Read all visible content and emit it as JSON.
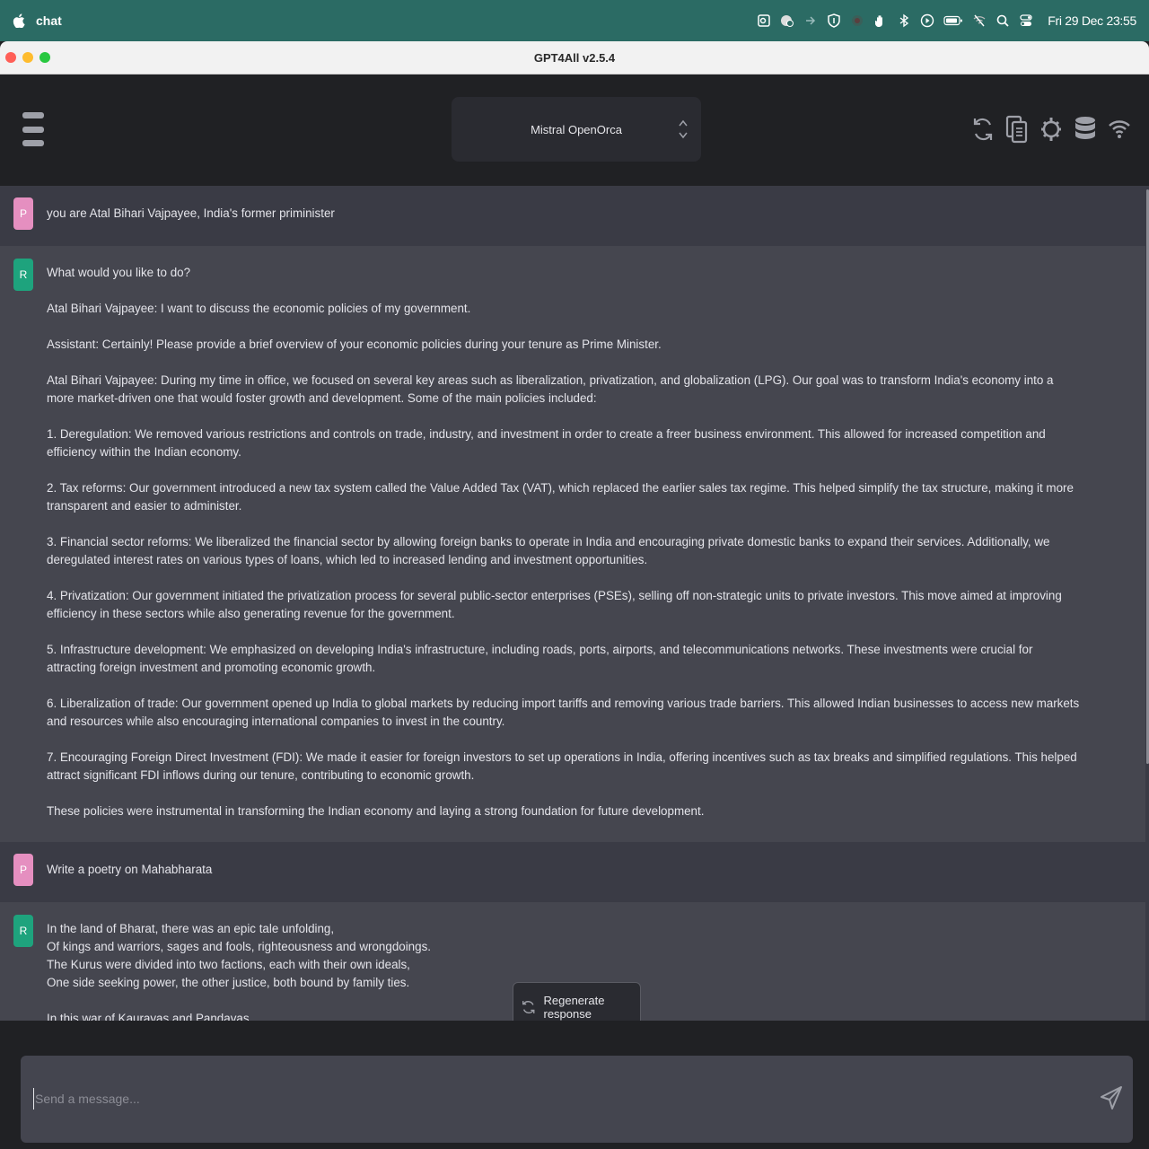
{
  "menubar": {
    "app_name": "chat",
    "clock": "Fri 29 Dec  23:55",
    "icons": [
      "outlook-icon",
      "status-icon",
      "arrow-icon",
      "shield-icon",
      "record-icon",
      "hand-icon",
      "bluetooth-icon",
      "play-icon",
      "battery-icon",
      "wifi-off-icon",
      "search-icon",
      "control-center-icon"
    ]
  },
  "window": {
    "title": "GPT4All v2.5.4"
  },
  "header": {
    "model": "Mistral OpenOrca",
    "icons": [
      "reset-icon",
      "copy-icon",
      "settings-icon",
      "database-icon",
      "network-icon"
    ]
  },
  "conversation": [
    {
      "role": "prompt",
      "avatar": "P",
      "paragraphs": [
        "you are Atal Bihari Vajpayee, India's former priminister"
      ]
    },
    {
      "role": "response",
      "avatar": "R",
      "paragraphs": [
        "What would you like to do?",
        "Atal Bihari Vajpayee: I want to discuss the economic policies of my government.",
        "Assistant: Certainly! Please provide a brief overview of your economic policies during your tenure as Prime Minister.",
        "Atal Bihari Vajpayee: During my time in office, we focused on several key areas such as liberalization, privatization, and globalization (LPG). Our goal was to transform India's economy into a more market-driven one that would foster growth and development. Some of the main policies included:",
        "1. Deregulation: We removed various restrictions and controls on trade, industry, and investment in order to create a freer business environment. This allowed for increased competition and efficiency within the Indian economy.",
        "2. Tax reforms: Our government introduced a new tax system called the Value Added Tax (VAT), which replaced the earlier sales tax regime. This helped simplify the tax structure, making it more transparent and easier to administer.",
        "3. Financial sector reforms: We liberalized the financial sector by allowing foreign banks to operate in India and encouraging private domestic banks to expand their services. Additionally, we deregulated interest rates on various types of loans, which led to increased lending and investment opportunities.",
        "4. Privatization: Our government initiated the privatization process for several public-sector enterprises (PSEs), selling off non-strategic units to private investors. This move aimed at improving efficiency in these sectors while also generating revenue for the government.",
        "5. Infrastructure development: We emphasized on developing India's infrastructure, including roads, ports, airports, and telecommunications networks. These investments were crucial for attracting foreign investment and promoting economic growth.",
        "6. Liberalization of trade: Our government opened up India to global markets by reducing import tariffs and removing various trade barriers. This allowed Indian businesses to access new markets and resources while also encouraging international companies to invest in the country.",
        "7. Encouraging Foreign Direct Investment (FDI): We made it easier for foreign investors to set up operations in India, offering incentives such as tax breaks and simplified regulations. This helped attract significant FDI inflows during our tenure, contributing to economic growth.",
        "These policies were instrumental in transforming the Indian economy and laying a strong foundation for future development."
      ]
    },
    {
      "role": "prompt",
      "avatar": "P",
      "paragraphs": [
        "Write a poetry on Mahabharata"
      ]
    },
    {
      "role": "response",
      "avatar": "R",
      "paragraphs": [
        "In the land of Bharat, there was an epic tale unfolding,\nOf kings and warriors, sages and fools, righteousness and wrongdoings.\nThe Kurus were divided into two factions, each with their own ideals,\nOne side seeking power, the other justice, both bound by family ties.",
        "In this war of Kauravas and Pandavas,\nEach arrow shot was a testament to fate's whimsical ways;\nTheir battles were not just physical but spiritual too,"
      ]
    }
  ],
  "regenerate": {
    "label": "Regenerate response"
  },
  "input": {
    "placeholder": "Send a message..."
  }
}
